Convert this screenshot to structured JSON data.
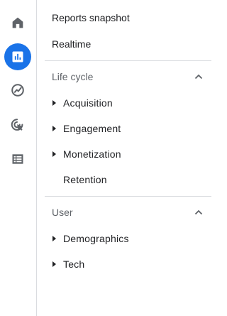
{
  "rail": {
    "items": [
      {
        "name": "home-icon"
      },
      {
        "name": "reports-icon",
        "active": true
      },
      {
        "name": "explore-icon"
      },
      {
        "name": "advertising-icon"
      },
      {
        "name": "configure-icon"
      }
    ],
    "accent": "#1a73e8"
  },
  "menu": {
    "reports_snapshot": "Reports snapshot",
    "realtime": "Realtime",
    "life_cycle": {
      "label": "Life cycle",
      "items": [
        {
          "label": "Acquisition",
          "expandable": true
        },
        {
          "label": "Engagement",
          "expandable": true
        },
        {
          "label": "Monetization",
          "expandable": true
        },
        {
          "label": "Retention",
          "expandable": false
        }
      ]
    },
    "user": {
      "label": "User",
      "items": [
        {
          "label": "Demographics",
          "expandable": true
        },
        {
          "label": "Tech",
          "expandable": true
        }
      ]
    }
  }
}
